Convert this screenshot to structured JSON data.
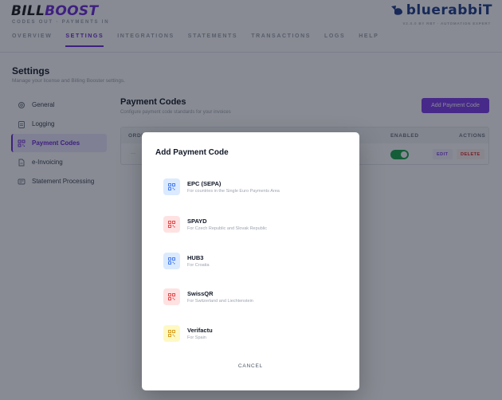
{
  "header": {
    "logo_left": "BILL",
    "logo_right": "BOOST",
    "tagline": "CODES OUT · PAYMENTS IN",
    "brand": "bluerabbiT",
    "version": "V2.0.0 BY RBT · AUTOMATION EXPERT",
    "tabs": [
      "OVERVIEW",
      "SETTINGS",
      "INTEGRATIONS",
      "STATEMENTS",
      "TRANSACTIONS",
      "LOGS",
      "HELP"
    ],
    "active_tab": "SETTINGS"
  },
  "page": {
    "title": "Settings",
    "subtitle": "Manage your license and Billing Booster settings."
  },
  "sidebar": {
    "items": [
      {
        "label": "General",
        "icon": "gear-icon"
      },
      {
        "label": "Logging",
        "icon": "clipboard-icon"
      },
      {
        "label": "Payment Codes",
        "icon": "qr-icon",
        "active": true
      },
      {
        "label": "e-Invoicing",
        "icon": "document-icon"
      },
      {
        "label": "Statement Processing",
        "icon": "statement-icon"
      }
    ]
  },
  "content": {
    "title": "Payment Codes",
    "subtitle": "Configure payment code standards for your invoices",
    "add_button": "Add Payment Code",
    "table": {
      "headers": {
        "order": "ORDER",
        "enabled": "ENABLED",
        "actions": "ACTIONS"
      },
      "row": {
        "order": "—",
        "edit": "EDIT",
        "delete": "DELETE",
        "enabled": true
      }
    }
  },
  "modal": {
    "title": "Add Payment Code",
    "options": [
      {
        "name": "EPC (SEPA)",
        "desc": "For countries in the Single Euro Payments Area",
        "color": "#dbeafe",
        "icon_color": "#2563eb"
      },
      {
        "name": "SPAYD",
        "desc": "For Czech Republic and Slovak Republic",
        "color": "#fee2e2",
        "icon_color": "#dc2626"
      },
      {
        "name": "HUB3",
        "desc": "For Croatia",
        "color": "#dbeafe",
        "icon_color": "#2563eb"
      },
      {
        "name": "SwissQR",
        "desc": "For Switzerland and Liechtenstein",
        "color": "#fee2e2",
        "icon_color": "#dc2626"
      },
      {
        "name": "Verifactu",
        "desc": "For Spain",
        "color": "#fef9c3",
        "icon_color": "#ca8a04"
      }
    ],
    "cancel": "CANCEL"
  }
}
